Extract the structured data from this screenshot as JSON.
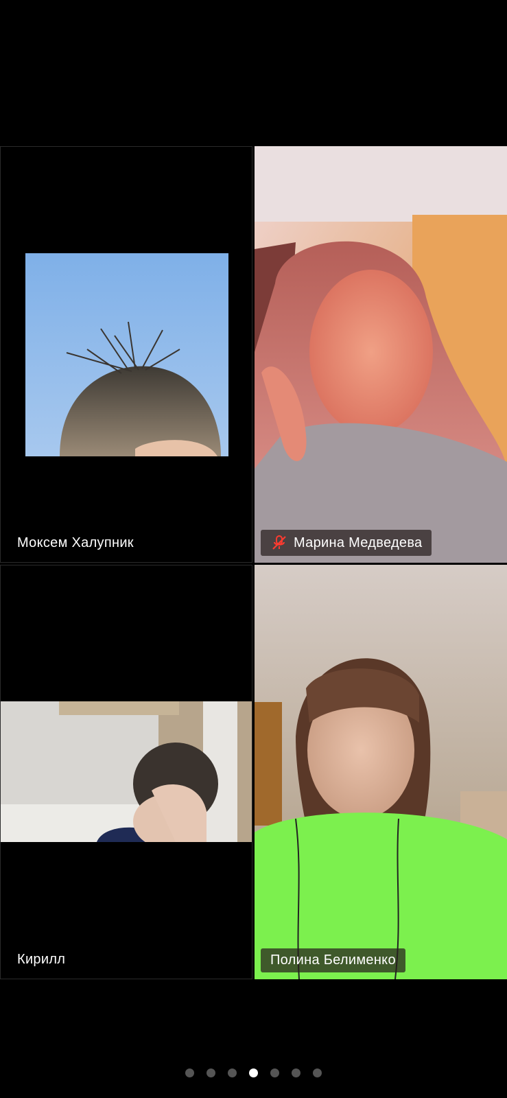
{
  "participants": [
    {
      "name": "Моксем Халупник",
      "muted": false,
      "avatar_icon": "hair-photo-icon"
    },
    {
      "name": "Марина Медведева",
      "muted": true,
      "mic_icon": "mic-muted-icon"
    },
    {
      "name": "Кирилл",
      "muted": false
    },
    {
      "name": "Полина Белименко",
      "muted": false
    }
  ],
  "pagination": {
    "total": 7,
    "active_index": 3
  },
  "colors": {
    "background": "#000000",
    "muted_mic": "#ff3b30",
    "active_dot": "#ffffff",
    "inactive_dot": "#555555"
  }
}
